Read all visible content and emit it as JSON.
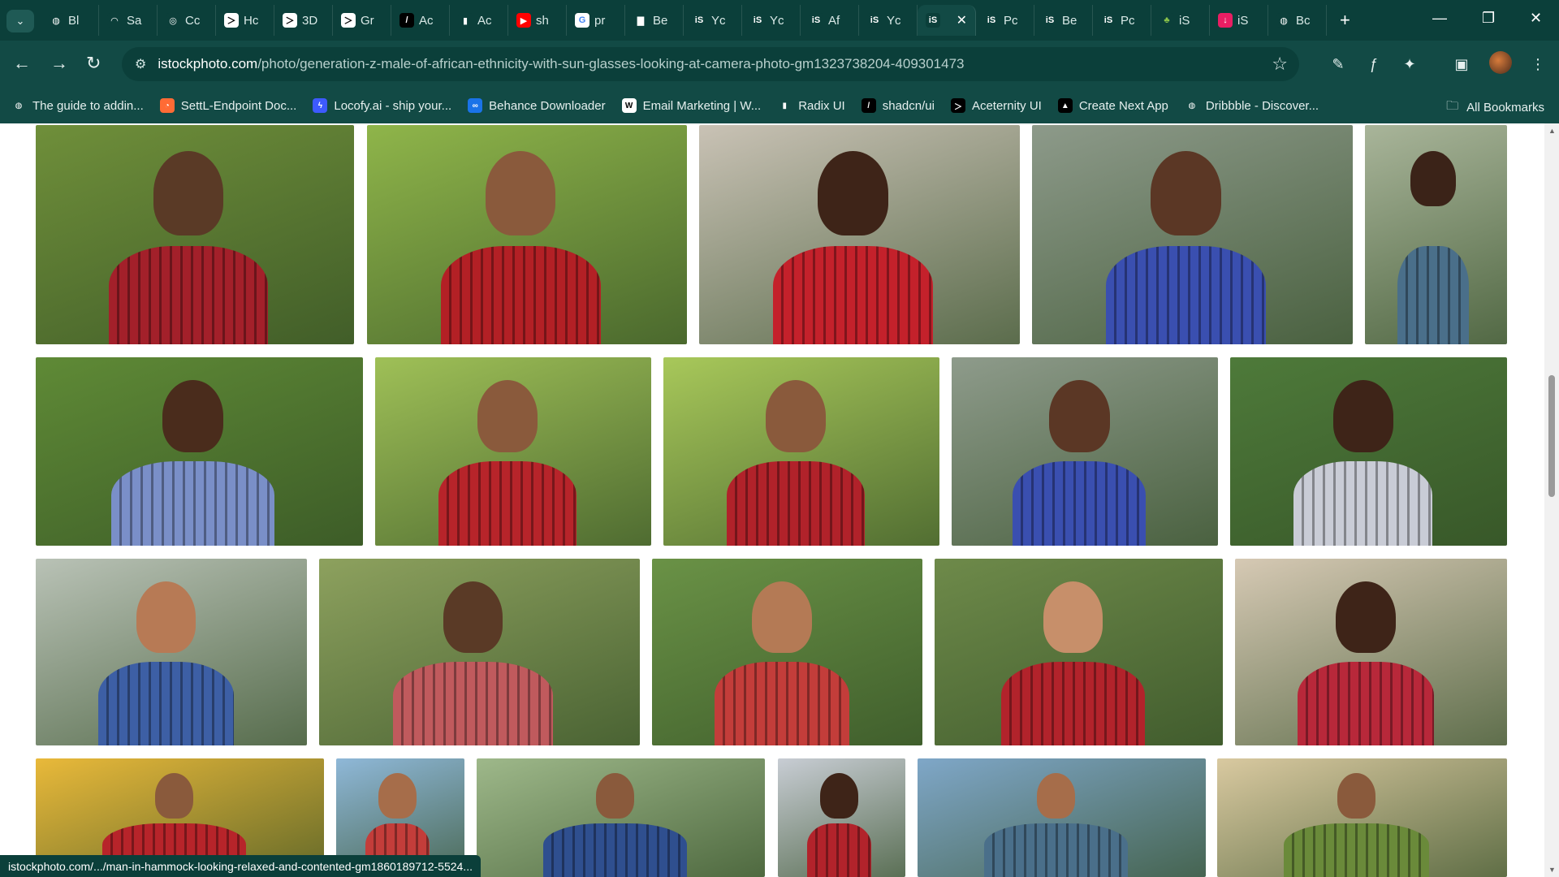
{
  "browser": {
    "tabs": [
      {
        "label": "Bl",
        "fav": "globe-icon",
        "bg": "#0b3f3a",
        "fg": "#ffffff",
        "glyph": "◍"
      },
      {
        "label": "Sa",
        "fav": "sa-icon",
        "bg": "#0b3f3a",
        "fg": "#ffffff",
        "glyph": "◠"
      },
      {
        "label": "Cc",
        "fav": "openai-icon",
        "bg": "#0b3f3a",
        "fg": "#ffffff",
        "glyph": "◎"
      },
      {
        "label": "Hc",
        "fav": "terminal-icon",
        "bg": "#ffffff",
        "fg": "#000000",
        "glyph": "＞"
      },
      {
        "label": "3D",
        "fav": "terminal-icon",
        "bg": "#ffffff",
        "fg": "#000000",
        "glyph": "＞"
      },
      {
        "label": "Gr",
        "fav": "terminal-icon",
        "bg": "#ffffff",
        "fg": "#000000",
        "glyph": "＞"
      },
      {
        "label": "Ac",
        "fav": "slash-icon",
        "bg": "#000000",
        "fg": "#ffffff",
        "glyph": "/"
      },
      {
        "label": "Ac",
        "fav": "radix-icon",
        "bg": "#0b3f3a",
        "fg": "#ffffff",
        "glyph": "▮"
      },
      {
        "label": "sh",
        "fav": "youtube-icon",
        "bg": "#ff0000",
        "fg": "#ffffff",
        "glyph": "▶"
      },
      {
        "label": "pr",
        "fav": "google-icon",
        "bg": "#ffffff",
        "fg": "#4285f4",
        "glyph": "G"
      },
      {
        "label": "Be",
        "fav": "bag-icon",
        "bg": "#0b3f3a",
        "fg": "#ffffff",
        "glyph": "▇"
      },
      {
        "label": "Yc",
        "fav": "istock-icon",
        "bg": "#0b3f3a",
        "fg": "#ffffff",
        "glyph": "iS"
      },
      {
        "label": "Yc",
        "fav": "istock-icon",
        "bg": "#0b3f3a",
        "fg": "#ffffff",
        "glyph": "iS"
      },
      {
        "label": "Af",
        "fav": "istock-icon",
        "bg": "#0b3f3a",
        "fg": "#ffffff",
        "glyph": "iS"
      },
      {
        "label": "Yc",
        "fav": "istock-icon",
        "bg": "#0b3f3a",
        "fg": "#ffffff",
        "glyph": "iS"
      },
      {
        "label": "",
        "fav": "istock-icon",
        "bg": "#0b3f3a",
        "fg": "#ffffff",
        "glyph": "iS",
        "active": true
      },
      {
        "label": "Pc",
        "fav": "istock-icon",
        "bg": "#0b3f3a",
        "fg": "#ffffff",
        "glyph": "iS"
      },
      {
        "label": "Be",
        "fav": "istock-icon",
        "bg": "#0b3f3a",
        "fg": "#ffffff",
        "glyph": "iS"
      },
      {
        "label": "Pc",
        "fav": "istock-icon",
        "bg": "#0b3f3a",
        "fg": "#ffffff",
        "glyph": "iS"
      },
      {
        "label": "iS",
        "fav": "plant-icon",
        "bg": "#0b3f3a",
        "fg": "#8bc34a",
        "glyph": "♣"
      },
      {
        "label": "iS",
        "fav": "download-icon",
        "bg": "#e91e63",
        "fg": "#ffffff",
        "glyph": "↓"
      },
      {
        "label": "Bc",
        "fav": "globe-icon",
        "bg": "#0b3f3a",
        "fg": "#ffffff",
        "glyph": "◍"
      }
    ],
    "close_glyph": "✕",
    "newtab_glyph": "+",
    "tabsearch_glyph": "⌄",
    "win": {
      "min": "—",
      "restore": "❐",
      "close": "✕"
    },
    "nav": {
      "back": "←",
      "forward": "→",
      "reload": "↻"
    },
    "url_host": "istockphoto.com",
    "url_path": "/photo/generation-z-male-of-african-ethnicity-with-sun-glasses-looking-at-camera-photo-gm1323738204-409301473",
    "site_info_glyph": "⚙",
    "star_glyph": "☆",
    "ext_glyphs": [
      "✎",
      "ƒ",
      "✦",
      "▣",
      "⋮"
    ],
    "bookmarks": [
      {
        "label": "The guide to addin...",
        "glyph": "◍",
        "bg": "#124a45",
        "fg": "#ffffff"
      },
      {
        "label": "SettL-Endpoint Doc...",
        "glyph": "◔",
        "bg": "#ff6b35",
        "fg": "#ffffff"
      },
      {
        "label": "Locofy.ai - ship your...",
        "glyph": "ϟ",
        "bg": "#3d5afe",
        "fg": "#ffffff"
      },
      {
        "label": "Behance Downloader",
        "glyph": "∞",
        "bg": "#1a73e8",
        "fg": "#ffffff"
      },
      {
        "label": "Email Marketing | W...",
        "glyph": "W",
        "bg": "#ffffff",
        "fg": "#000000"
      },
      {
        "label": "Radix UI",
        "glyph": "▮",
        "bg": "#124a45",
        "fg": "#ffffff"
      },
      {
        "label": "shadcn/ui",
        "glyph": "/",
        "bg": "#000000",
        "fg": "#ffffff"
      },
      {
        "label": "Aceternity UI",
        "glyph": "＞",
        "bg": "#000000",
        "fg": "#ffffff"
      },
      {
        "label": "Create Next App",
        "glyph": "▲",
        "bg": "#000000",
        "fg": "#ffffff"
      },
      {
        "label": "Dribbble - Discover...",
        "glyph": "◍",
        "bg": "#124a45",
        "fg": "#ffffff"
      }
    ],
    "all_bookmarks": "All Bookmarks",
    "status_url": "istockphoto.com/.../man-in-hammock-looking-relaxed-and-contented-gm1860189712-5524..."
  },
  "gallery": {
    "photos": [
      {
        "name": "photo-senior-couple-hug",
        "bg": "#6f8f3a",
        "skin": "#5a3a26",
        "shirt": "#a3202a"
      },
      {
        "name": "photo-man-glasses-laptop",
        "bg": "#8fb54a",
        "skin": "#8a5a3c",
        "shirt": "#b32025"
      },
      {
        "name": "photo-man-red-plaid-street",
        "bg": "#c9c2b5",
        "skin": "#3e2418",
        "shirt": "#c4212b"
      },
      {
        "name": "photo-group-walking-backpack",
        "bg": "#8d9a8a",
        "skin": "#5b3725",
        "shirt": "#3a4fb0"
      },
      {
        "name": "photo-man-camera",
        "bg": "#a9b59a",
        "skin": "#3b2318",
        "shirt": "#4a6f8a"
      },
      {
        "name": "photo-two-friends-plaid",
        "bg": "#5f8a36",
        "skin": "#4a2c1c",
        "shirt": "#7a8fc8"
      },
      {
        "name": "photo-man-hammock-glasses",
        "bg": "#9fc057",
        "skin": "#8a5a3c",
        "shirt": "#b7242a"
      },
      {
        "name": "photo-man-hammock-smiling",
        "bg": "#a8c85a",
        "skin": "#8a5a3c",
        "shirt": "#b1222a"
      },
      {
        "name": "photo-group-walking-backpack-2",
        "bg": "#8e9b8b",
        "skin": "#5b3725",
        "shirt": "#3a4fb0"
      },
      {
        "name": "photo-man-looking-up",
        "bg": "#4e7a3a",
        "skin": "#3e2418",
        "shirt": "#c9ccd6"
      },
      {
        "name": "photo-couple-festival-flowers",
        "bg": "#b9c2b6",
        "skin": "#b77a55",
        "shirt": "#3d5fa5"
      },
      {
        "name": "photo-couple-embrace",
        "bg": "#8da15e",
        "skin": "#5a3a26",
        "shirt": "#c05a5d"
      },
      {
        "name": "photo-couple-sunglasses",
        "bg": "#6a9246",
        "skin": "#b47a55",
        "shirt": "#c33d3a"
      },
      {
        "name": "photo-friends-party",
        "bg": "#6e8a4a",
        "skin": "#c78f6a",
        "shirt": "#b2232b"
      },
      {
        "name": "photo-man-side-profile",
        "bg": "#d6c9b4",
        "skin": "#3e2418",
        "shirt": "#b8283a"
      },
      {
        "name": "photo-man-hammock-relaxed",
        "bg": "#e9b93a",
        "skin": "#8a5a3c",
        "shirt": "#b7242a"
      },
      {
        "name": "photo-couple-selfie",
        "bg": "#8fb8d8",
        "skin": "#a66d4a",
        "shirt": "#c33d3a"
      },
      {
        "name": "photo-couple-laughing",
        "bg": "#9eb88a",
        "skin": "#8a5a3c",
        "shirt": "#2f4f8f"
      },
      {
        "name": "photo-woman-city",
        "bg": "#c8cdd4",
        "skin": "#3e2418",
        "shirt": "#b2232b"
      },
      {
        "name": "photo-friends-smiling-sky",
        "bg": "#7fa7c8",
        "skin": "#a66d4a",
        "shirt": "#4a6f8a"
      },
      {
        "name": "photo-man-glasses-sun",
        "bg": "#d9c9a0",
        "skin": "#8a5a3c",
        "shirt": "#6a8a3a"
      }
    ]
  }
}
